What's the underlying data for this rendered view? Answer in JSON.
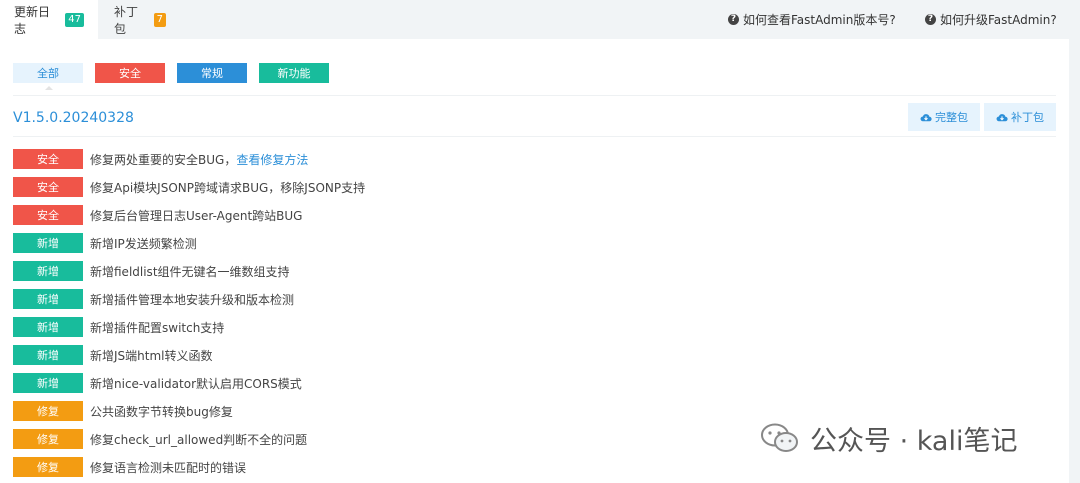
{
  "tabs": [
    {
      "label": "更新日志",
      "count": "47"
    },
    {
      "label": "补丁包",
      "count": "7"
    }
  ],
  "help_links": [
    {
      "label": "如何查看FastAdmin版本号?"
    },
    {
      "label": "如何升级FastAdmin?"
    }
  ],
  "filters": [
    {
      "label": "全部"
    },
    {
      "label": "安全"
    },
    {
      "label": "常规"
    },
    {
      "label": "新功能"
    }
  ],
  "version": {
    "title": "V1.5.0.20240328",
    "full_package_label": "完整包",
    "patch_label": "补丁包"
  },
  "entries": [
    {
      "tag": "安全",
      "text": "修复两处重要的安全BUG，",
      "link": "查看修复方法"
    },
    {
      "tag": "安全",
      "text": "修复Api模块JSONP跨域请求BUG，移除JSONP支持"
    },
    {
      "tag": "安全",
      "text": "修复后台管理日志User-Agent跨站BUG"
    },
    {
      "tag": "新增",
      "text": "新增IP发送频繁检测"
    },
    {
      "tag": "新增",
      "text": "新增fieldlist组件无键名一维数组支持"
    },
    {
      "tag": "新增",
      "text": "新增插件管理本地安装升级和版本检测"
    },
    {
      "tag": "新增",
      "text": "新增插件配置switch支持"
    },
    {
      "tag": "新增",
      "text": "新增JS端html转义函数"
    },
    {
      "tag": "新增",
      "text": "新增nice-validator默认启用CORS模式"
    },
    {
      "tag": "修复",
      "text": "公共函数字节转换bug修复"
    },
    {
      "tag": "修复",
      "text": "修复check_url_allowed判断不全的问题"
    },
    {
      "tag": "修复",
      "text": "修复语言检测未匹配时的错误"
    }
  ],
  "watermark": {
    "text": "公众号 · kali笔记"
  },
  "colors": {
    "security": "#f05549",
    "regular": "#2c8fd8",
    "feature": "#18bc9c",
    "fix": "#f39c12"
  }
}
